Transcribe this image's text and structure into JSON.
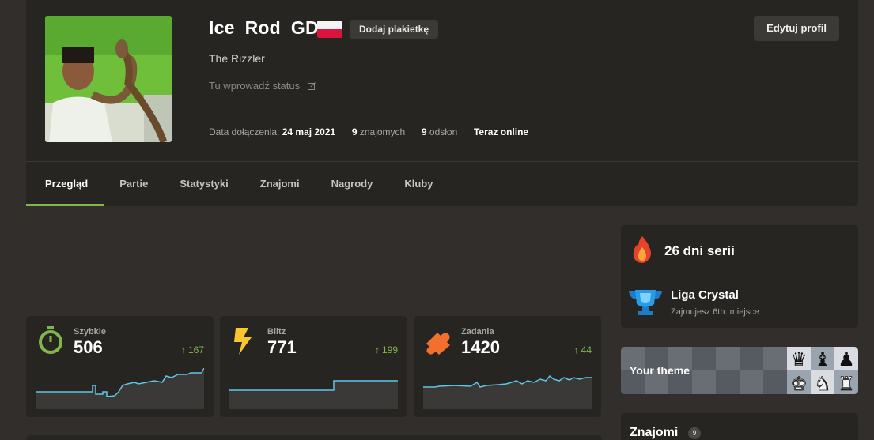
{
  "profile": {
    "username": "Ice_Rod_GD",
    "badge_button": "Dodaj plakietkę",
    "edit_button": "Edytuj profil",
    "real_name": "The Rizzler",
    "status_placeholder": "Tu wprowadź status",
    "meta": {
      "joined_label": "Data dołączenia:",
      "joined_date": "24 maj 2021",
      "friends_count": "9",
      "friends_label": "znajomych",
      "views_count": "9",
      "views_label": "odsłon",
      "online": "Teraz online"
    },
    "flag_colors": [
      "#f4f4f4",
      "#dc143c"
    ]
  },
  "tabs": [
    {
      "label": "Przegląd",
      "active": true
    },
    {
      "label": "Partie"
    },
    {
      "label": "Statystyki"
    },
    {
      "label": "Znajomi"
    },
    {
      "label": "Nagrody"
    },
    {
      "label": "Kluby"
    }
  ],
  "stats": [
    {
      "label": "Szybkie",
      "rating": "506",
      "delta": "167",
      "icon": "stopwatch-icon",
      "color": "#81b64c"
    },
    {
      "label": "Blitz",
      "rating": "771",
      "delta": "199",
      "icon": "lightning-icon",
      "color": "#f7c631"
    },
    {
      "label": "Zadania",
      "rating": "1420",
      "delta": "44",
      "icon": "puzzle-icon",
      "color": "#f1702e"
    }
  ],
  "streak": {
    "text": "26 dni serii",
    "icon": "flame-icon"
  },
  "league": {
    "title": "Liga Crystal",
    "subtitle": "Zajmujesz 6th. miejsce",
    "icon": "trophy-icon"
  },
  "theme": {
    "label": "Your theme"
  },
  "friends": {
    "title": "Znajomi",
    "count": "9"
  },
  "colors": {
    "accent": "#81b64c",
    "background": "#312e2b",
    "card": "#262522",
    "sparkline": "#5fc6e9"
  }
}
